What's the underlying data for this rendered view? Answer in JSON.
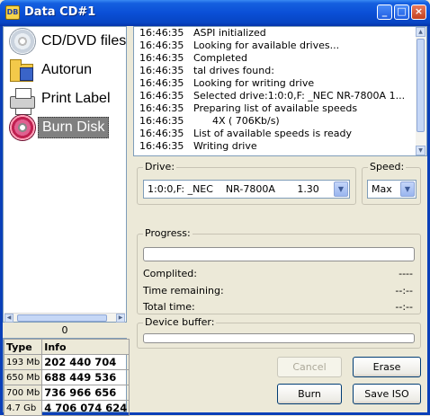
{
  "window": {
    "title": "Data CD#1",
    "app_icon_text": "DB"
  },
  "nav": {
    "items": [
      {
        "label": "CD/DVD files",
        "icon": "cd-icon"
      },
      {
        "label": "Autorun",
        "icon": "folder-icon"
      },
      {
        "label": "Print Label",
        "icon": "printer-icon"
      },
      {
        "label": "Burn Disk",
        "icon": "burn-disk-icon",
        "selected": true
      }
    ]
  },
  "counter": "0",
  "info_table": {
    "headers": [
      "Type",
      "Info"
    ],
    "rows": [
      {
        "size": "193 Mb",
        "value": "202 440 704"
      },
      {
        "size": "650 Mb",
        "value": "688 449 536"
      },
      {
        "size": "700 Mb",
        "value": "736 966 656"
      },
      {
        "size": "4.7 Gb",
        "value": "4 706 074 624"
      }
    ]
  },
  "log": [
    {
      "time": "16:46:35",
      "msg": "ASPI initialized"
    },
    {
      "time": "16:46:35",
      "msg": "Looking for available drives..."
    },
    {
      "time": "16:46:35",
      "msg": "Completed"
    },
    {
      "time": "16:46:35",
      "msg": "tal drives found:"
    },
    {
      "time": "16:46:35",
      "msg": "Looking for writing drive"
    },
    {
      "time": "16:46:35",
      "msg": "Selected drive:1:0:0,F: _NEC    NR-7800A      1..."
    },
    {
      "time": "16:46:35",
      "msg": "Preparing list of available speeds"
    },
    {
      "time": "16:46:35",
      "msg": "      4X ( 706Kb/s)"
    },
    {
      "time": "16:46:35",
      "msg": "List of available speeds is ready"
    },
    {
      "time": "16:46:35",
      "msg": "Writing drive"
    }
  ],
  "drive": {
    "label": "Drive:",
    "value": "1:0:0,F: _NEC    NR-7800A       1.30"
  },
  "speed": {
    "label": "Speed:",
    "value": "Max"
  },
  "progress": {
    "label": "Progress:",
    "fill": 0,
    "completed_label": "Complited:",
    "completed_value": "----",
    "remaining_label": "Time remaining:",
    "remaining_value": "--:--",
    "total_label": "Total time:",
    "total_value": "--:--"
  },
  "buffer": {
    "label": "Device buffer:",
    "fill": 0
  },
  "buttons": {
    "cancel": "Cancel",
    "erase": "Erase",
    "burn": "Burn",
    "save_iso": "Save ISO"
  },
  "title_buttons": {
    "minimize": "_",
    "maximize": "□",
    "close": "×"
  },
  "colors": {
    "title_bar": "#0a4fd6",
    "selected_nav": "#808080"
  }
}
